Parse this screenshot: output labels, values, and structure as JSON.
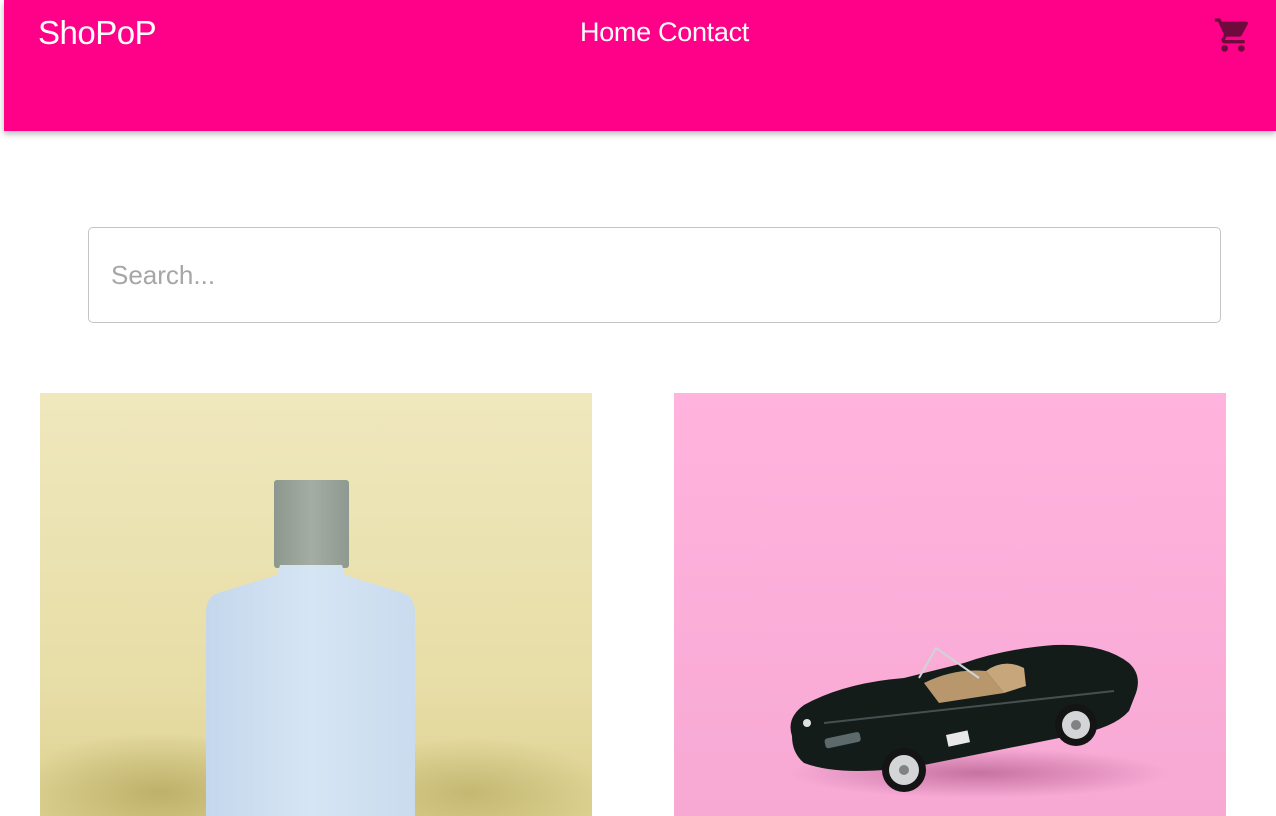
{
  "header": {
    "brand": "ShoPoP",
    "nav": {
      "home": "Home",
      "contact": "Contact"
    },
    "cart_icon": "shopping-cart-icon",
    "background_color": "#ff0088"
  },
  "search": {
    "placeholder": "Search...",
    "value": ""
  },
  "products": [
    {
      "image_subject": "cologne-bottle-image",
      "background_color": "#ede5b4"
    },
    {
      "image_subject": "toy-car-image",
      "background_color": "#fbb0da"
    }
  ]
}
